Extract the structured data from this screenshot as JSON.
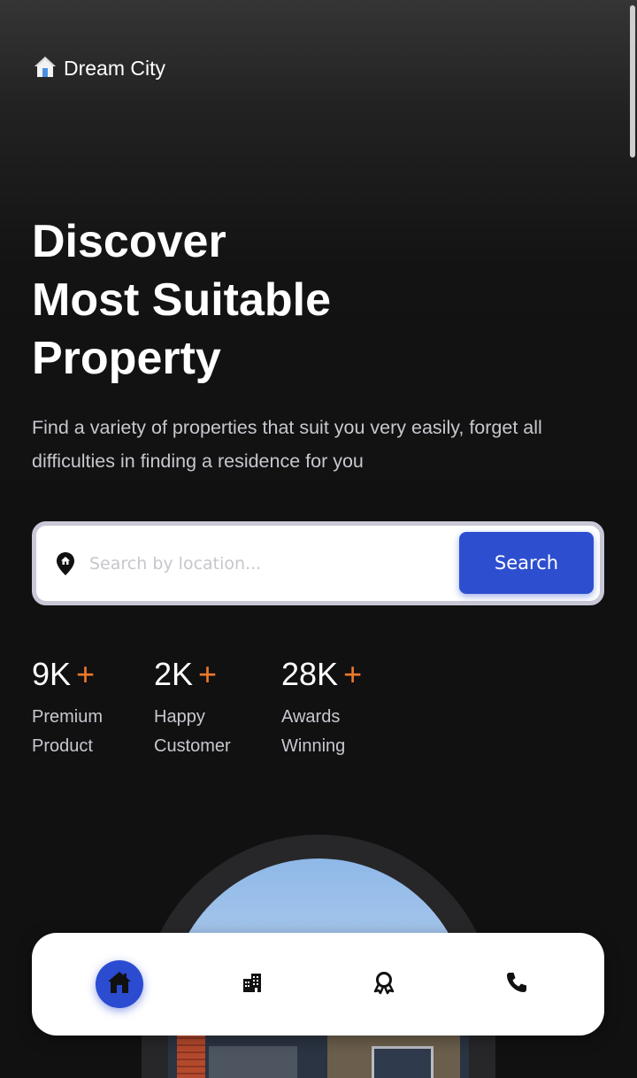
{
  "app": {
    "name": "Dream City"
  },
  "hero": {
    "title_lines": [
      "Discover",
      "Most Suitable",
      "Property"
    ],
    "subtitle": "Find a variety of properties that suit you very easily, forget all difficulties in finding a residence for you"
  },
  "search": {
    "placeholder": "Search by location...",
    "button_label": "Search"
  },
  "stats": [
    {
      "number": "9K",
      "plus": "+",
      "label": "Premium Product"
    },
    {
      "number": "2K",
      "plus": "+",
      "label": "Happy Customer"
    },
    {
      "number": "28K",
      "plus": "+",
      "label": "Awards Winning"
    }
  ],
  "nav": {
    "items": [
      {
        "icon": "home-icon",
        "active": true
      },
      {
        "icon": "building-icon",
        "active": false
      },
      {
        "icon": "award-icon",
        "active": false
      },
      {
        "icon": "phone-icon",
        "active": false
      }
    ]
  },
  "colors": {
    "accent": "#2d4fcf",
    "plus": "#f07a2a",
    "background": "#111112"
  }
}
